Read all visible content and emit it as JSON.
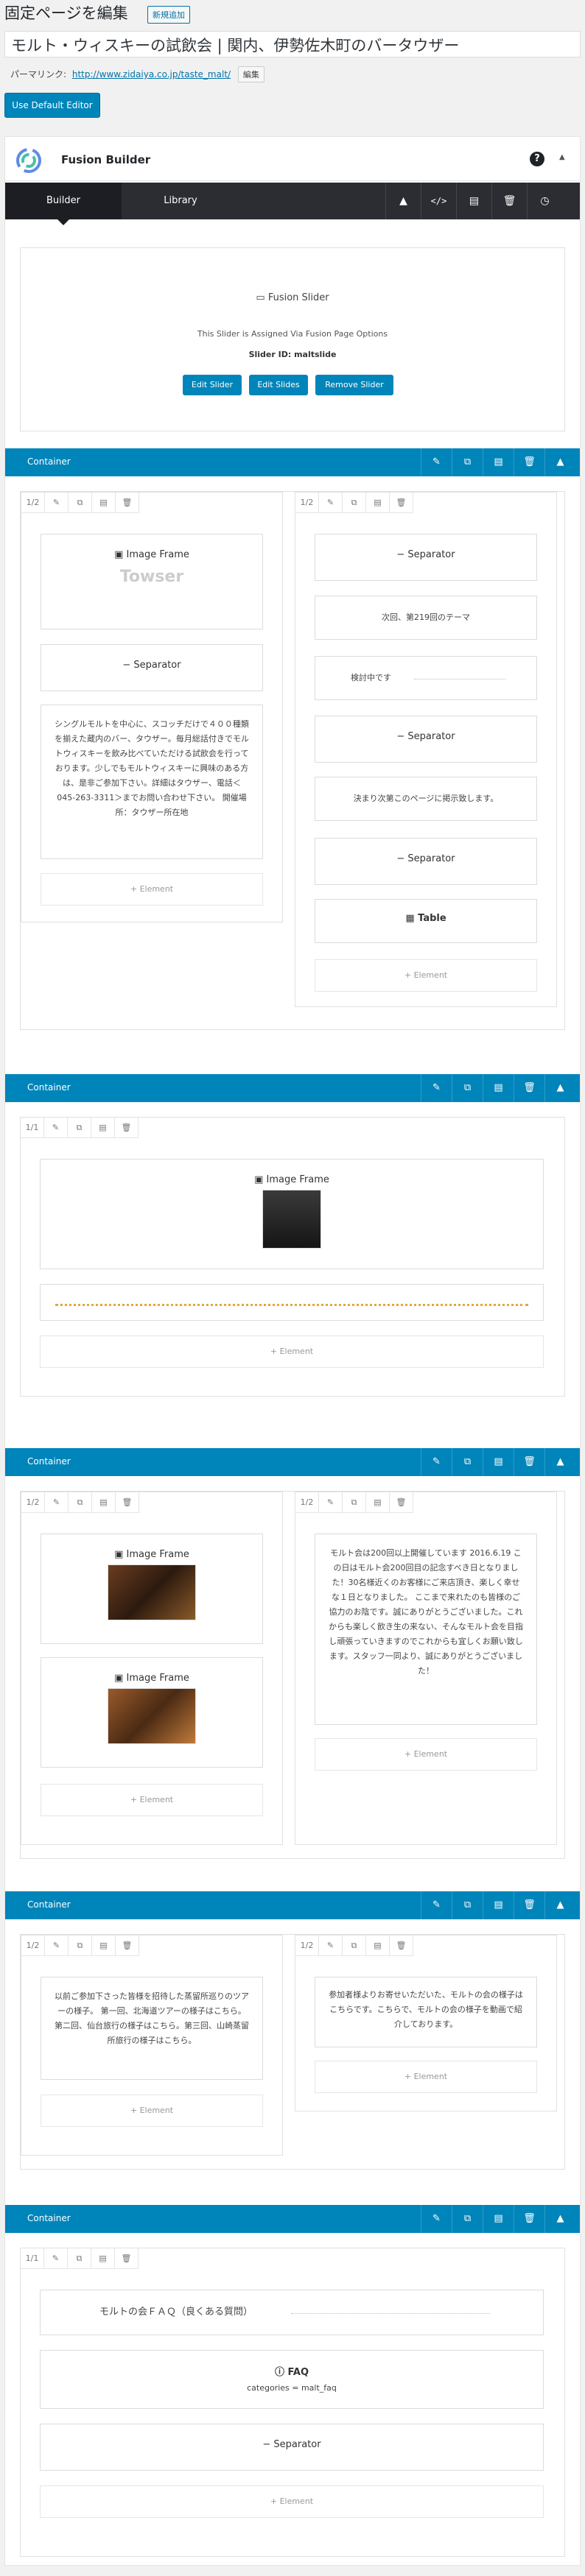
{
  "page": {
    "heading": "固定ページを編集",
    "add_new": "新規追加",
    "title_value": "モルト・ウィスキーの試飲会 | 関内、伊勢佐木町のバータウザー",
    "permalink_label": "パーマリンク:",
    "permalink_url": "http://www.zidaiya.co.jp/taste_malt/",
    "permalink_edit": "編集",
    "default_editor": "Use Default Editor"
  },
  "builder": {
    "title": "Fusion Builder",
    "help": "?",
    "tabs": [
      "Builder",
      "Library"
    ]
  },
  "slider": {
    "name": "Fusion Slider",
    "note": "This Slider is Assigned Via Fusion Page Options",
    "slider_id": "Slider ID: maltslide",
    "buttons": [
      "Edit Slider",
      "Edit Slides",
      "Remove Slider"
    ]
  },
  "container_label": "Container",
  "col_half": "1/2",
  "col_full": "1/1",
  "add_element": "+ Element",
  "labels": {
    "image_frame": "Image Frame",
    "separator": "Separator",
    "table": "Table",
    "faq": "FAQ"
  },
  "c1": {
    "left_text": "シングルモルトを中心に、スコッチだけで４００種類を揃えた蔵内のバー、タウザー。毎月総話付きでモルトウィスキーを飲み比べていただける試飲会を行っております。少しでもモルトウィスキーに興味のある方は、是非ご参加下さい。詳細はタウザー、電話＜045-263-3311＞までお問い合わせ下さい。 開催場所：タウザー所在地",
    "right_next": "次回、第219回のテーマ",
    "right_tbd": "検討中です",
    "right_notice": "決まり次第このページに掲示致します。"
  },
  "c3": {
    "right_text": "モルト会は200回以上開催しています 2016.6.19 この日はモルト会200回目の記念すべき日となりました！30名様近くのお客様にご来店頂き、楽しく幸せな１日となりました。 ここまで来れたのも皆様のご協力のお陰です。誠にありがとうございました。これからも楽しく飲き生の来ない、そんなモルト会を目指し頑張っていきますのでこれからも宜しくお願い致します。スタッフ一同より、誠にありがとうございました！"
  },
  "c4": {
    "left_text": "以前ご参加下さった皆様を招待した蒸留所巡りのツアーの様子。 第一回、北海道ツアーの様子はこちら。第二回、仙台旅行の様子はこちら。第三回、山崎蒸留所旅行の様子はこちら。",
    "right_text": "参加者様よりお寄せいただいた、モルトの会の様子はこちらです。こちらで、モルトの会の様子を動画で紹介しております。"
  },
  "c5": {
    "faq_heading": "モルトの会ＦＡＱ（良くある質問）",
    "faq_categories": "categories = malt_faq"
  },
  "logo_text": "Towser"
}
